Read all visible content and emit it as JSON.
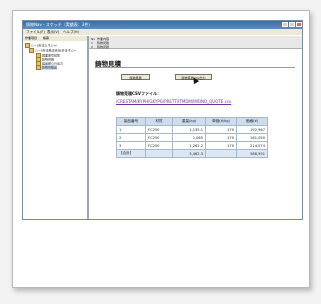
{
  "window": {
    "title": "鋳物Nav - スケッチ（実績表：3件）",
    "menus": [
      "ファイル(F)",
      "表示(V)",
      "ヘルプ(H)"
    ]
  },
  "left_pane": {
    "tabs": [
      "作業項目",
      "帳票"
    ],
    "tree": [
      {
        "label": "○ーS外注1(ネジ)+"
      },
      {
        "label": "○ーS外注受注状況(外注ネジ+"
      },
      {
        "label": "図面番号検索"
      },
      {
        "label": "鋳物見積"
      },
      {
        "label": "製品部CSV出力"
      },
      {
        "label": "鋳物見積出"
      }
    ]
  },
  "right_pane": {
    "subheader": {
      "col1": "No",
      "col2": "作業内容",
      "rows": [
        "1",
        "2"
      ],
      "items": [
        "鋳物見積",
        "鋳物見積"
      ]
    },
    "page_title": "鋳物見積",
    "buttons": {
      "estimate": "鋳物見積",
      "csv_output": "鋳物見積CSV出力"
    },
    "csv_label": "鋳物見積CSVファイル：",
    "csv_link": "/CRESTAM/KYPH/GKYPG/PRETTXTMDM/IMONO_QUOTE.csv",
    "table": {
      "headers": [
        "製品番号",
        "材質",
        "重量(kg)",
        "単価(¥/kg)",
        "価格(¥)"
      ],
      "rows": [
        [
          "1",
          "FC250",
          "1,135.1",
          "170",
          "192,967"
        ],
        [
          "2",
          "FC250",
          "1,065",
          "170",
          "181,050"
        ],
        [
          "3",
          "FC250",
          "1,262.2",
          "170",
          "214,574"
        ]
      ],
      "total": [
        "【合計】",
        "",
        "3,462.3",
        "",
        "588,591"
      ]
    }
  }
}
